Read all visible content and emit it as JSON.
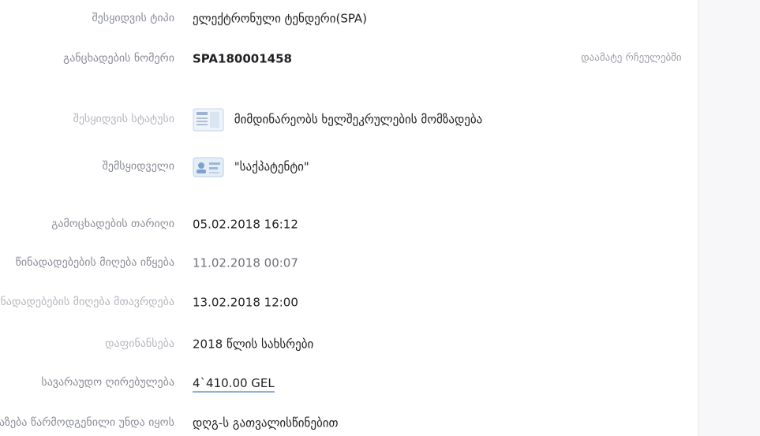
{
  "tender": {
    "rows": [
      {
        "label": "შესყიდვის ტიპი",
        "value": "ელექტრონული ტენდერი(SPA)"
      },
      {
        "label": "განცხადების ნომერი",
        "value": "SPA180001458"
      },
      {
        "label": "შესყიდვის სტატუსი",
        "value": "მიმდინარეობს ხელშეკრულების მომზადება"
      },
      {
        "label": "შემსყიდველი",
        "value": "\"საქპატენტი\""
      },
      {
        "label": "გამოცხადების თარიღი",
        "value": "05.02.2018 16:12"
      },
      {
        "label": "წინადადებების მიღება იწყება",
        "value": "11.02.2018 00:07"
      },
      {
        "label": "წინადადებების მიღება მთავრდება",
        "value": "13.02.2018 12:00"
      },
      {
        "label": "დაფინანსება",
        "value": "2018 წლის სახსრები"
      },
      {
        "label": "სავარაუდო ღირებულება",
        "value": "4`410.00 GEL"
      },
      {
        "label": "შეთავაზება წარმოდგენილი უნდა იყოს",
        "value": "დღგ-ს გათვალისწინებით"
      }
    ],
    "add_to_favorites": "დაამატე რჩეულებში"
  },
  "icons": {
    "status": "document-card-icon",
    "buyer": "id-card-icon"
  },
  "colors": {
    "label": "#8a8d96",
    "value": "#1f2023",
    "price_underline": "#8fb1d6",
    "side_panel": "#f7f7f9"
  }
}
